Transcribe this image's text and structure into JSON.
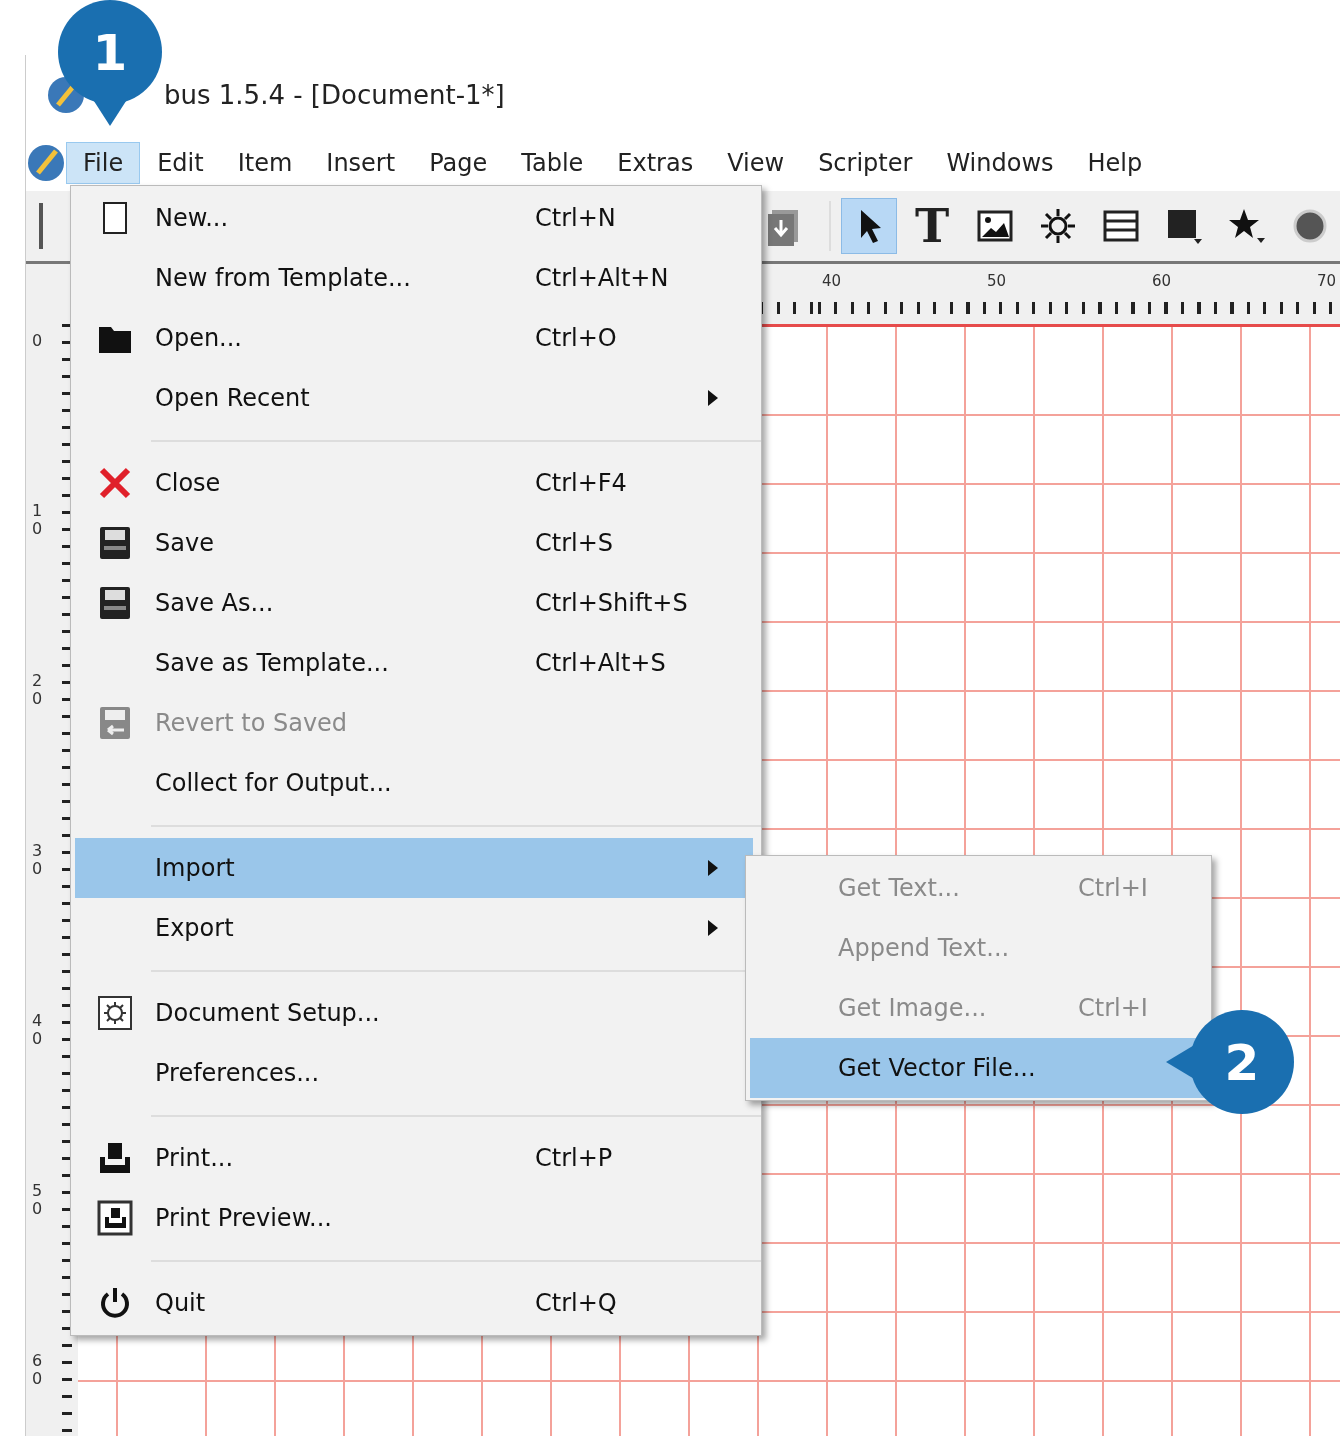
{
  "window": {
    "title": "bus 1.5.4 - [Document-1*]"
  },
  "menu_bar": [
    {
      "label": "File",
      "selected": true
    },
    {
      "label": "Edit",
      "selected": false
    },
    {
      "label": "Item",
      "selected": false
    },
    {
      "label": "Insert",
      "selected": false
    },
    {
      "label": "Page",
      "selected": false
    },
    {
      "label": "Table",
      "selected": false
    },
    {
      "label": "Extras",
      "selected": false
    },
    {
      "label": "View",
      "selected": false
    },
    {
      "label": "Scripter",
      "selected": false
    },
    {
      "label": "Windows",
      "selected": false
    },
    {
      "label": "Help",
      "selected": false
    }
  ],
  "toolbar": [
    {
      "kind": "export",
      "selected": false
    },
    {
      "kind": "pointer",
      "selected": true
    },
    {
      "kind": "text",
      "glyph": "T",
      "selected": false
    },
    {
      "kind": "image",
      "selected": false
    },
    {
      "kind": "render",
      "selected": false
    },
    {
      "kind": "table",
      "selected": false
    },
    {
      "kind": "shape",
      "selected": false
    },
    {
      "kind": "star",
      "selected": false
    },
    {
      "kind": "circle",
      "selected": false
    }
  ],
  "top_ruler": [
    "40",
    "50",
    "60",
    "70"
  ],
  "left_ruler": [
    "0",
    "10",
    "20",
    "30",
    "40",
    "50",
    "60"
  ],
  "file_menu": [
    {
      "kind": "item",
      "label": "New...",
      "shortcut": "Ctrl+N",
      "submenu": false,
      "disabled": false,
      "selected": false
    },
    {
      "kind": "item",
      "label": "New from Template...",
      "shortcut": "Ctrl+Alt+N",
      "submenu": false,
      "disabled": false,
      "selected": false
    },
    {
      "kind": "item",
      "label": "Open...",
      "shortcut": "Ctrl+O",
      "submenu": false,
      "disabled": false,
      "selected": false
    },
    {
      "kind": "item",
      "label": "Open Recent",
      "submenu": true,
      "disabled": false,
      "selected": false
    },
    {
      "kind": "separator"
    },
    {
      "kind": "item",
      "label": "Close",
      "shortcut": "Ctrl+F4",
      "submenu": false,
      "disabled": false,
      "selected": false
    },
    {
      "kind": "item",
      "label": "Save",
      "shortcut": "Ctrl+S",
      "submenu": false,
      "disabled": false,
      "selected": false
    },
    {
      "kind": "item",
      "label": "Save As...",
      "shortcut": "Ctrl+Shift+S",
      "submenu": false,
      "disabled": false,
      "selected": false
    },
    {
      "kind": "item",
      "label": "Save as Template...",
      "shortcut": "Ctrl+Alt+S",
      "submenu": false,
      "disabled": false,
      "selected": false
    },
    {
      "kind": "item",
      "label": "Revert to Saved",
      "submenu": false,
      "disabled": true,
      "selected": false
    },
    {
      "kind": "item",
      "label": "Collect for Output...",
      "submenu": false,
      "disabled": false,
      "selected": false
    },
    {
      "kind": "separator"
    },
    {
      "kind": "item",
      "label": "Import",
      "submenu": true,
      "disabled": false,
      "selected": true
    },
    {
      "kind": "item",
      "label": "Export",
      "submenu": true,
      "disabled": false,
      "selected": false
    },
    {
      "kind": "separator"
    },
    {
      "kind": "item",
      "label": "Document Setup...",
      "submenu": false,
      "disabled": false,
      "selected": false
    },
    {
      "kind": "item",
      "label": "Preferences...",
      "submenu": false,
      "disabled": false,
      "selected": false
    },
    {
      "kind": "separator"
    },
    {
      "kind": "item",
      "label": "Print...",
      "shortcut": "Ctrl+P",
      "submenu": false,
      "disabled": false,
      "selected": false
    },
    {
      "kind": "item",
      "label": "Print Preview...",
      "submenu": false,
      "disabled": false,
      "selected": false
    },
    {
      "kind": "separator"
    },
    {
      "kind": "item",
      "label": "Quit",
      "shortcut": "Ctrl+Q",
      "submenu": false,
      "disabled": false,
      "selected": false
    }
  ],
  "import_submenu": [
    {
      "label": "Get Text...",
      "shortcut": "Ctrl+I",
      "disabled": true,
      "selected": false
    },
    {
      "label": "Append Text...",
      "disabled": true,
      "selected": false
    },
    {
      "label": "Get Image...",
      "shortcut": "Ctrl+I",
      "disabled": true,
      "selected": false
    },
    {
      "label": "Get Vector File...",
      "disabled": false,
      "selected": true
    }
  ],
  "callouts": [
    {
      "label": "1"
    },
    {
      "label": "2"
    }
  ]
}
